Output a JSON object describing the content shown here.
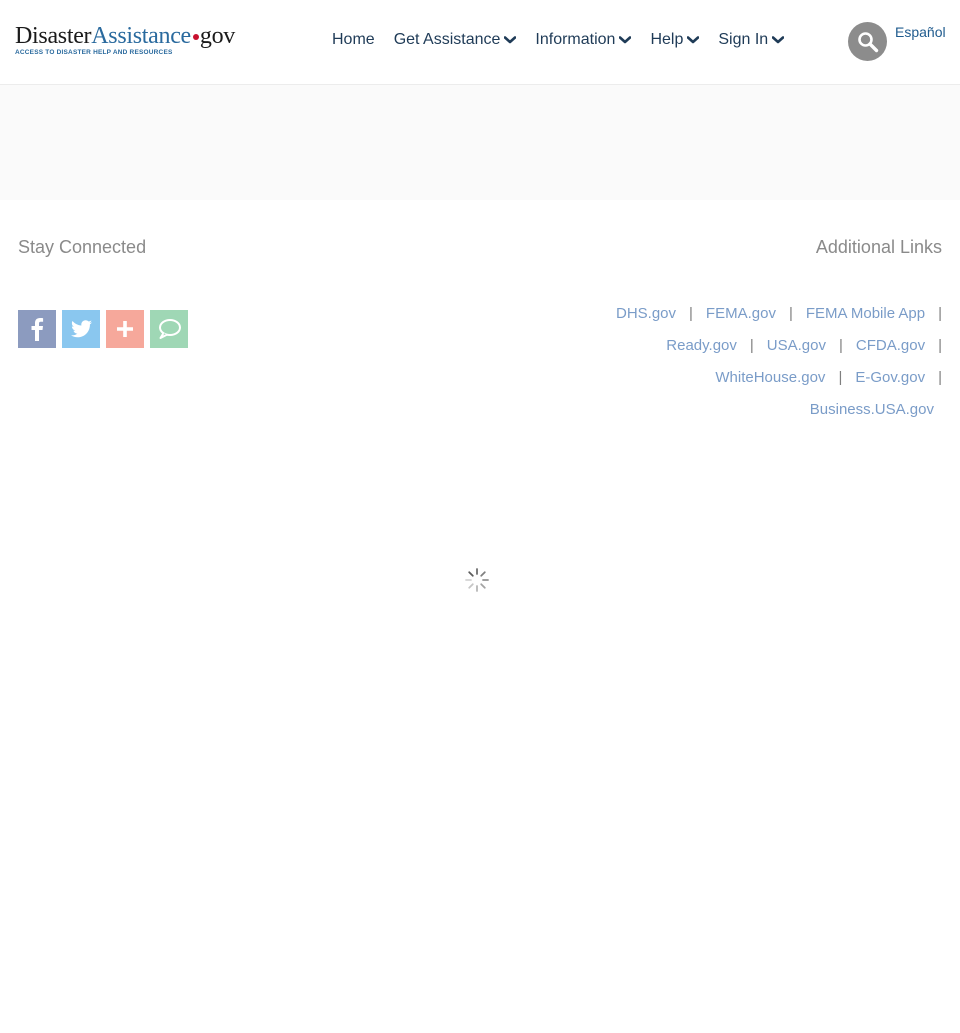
{
  "logo": {
    "part1": "Disaster",
    "part2": "Assistance",
    "part3": "gov",
    "tagline": "ACCESS TO DISASTER HELP AND RESOURCES"
  },
  "nav": {
    "home": "Home",
    "get_assistance": "Get Assistance",
    "information": "Information",
    "help": "Help",
    "sign_in": "Sign In"
  },
  "search_icon": "search-icon",
  "language_link": "Español",
  "stay_connected": {
    "title": "Stay Connected",
    "icons": [
      "facebook-icon",
      "twitter-icon",
      "share-plus-icon",
      "chat-bubble-icon"
    ],
    "colors": {
      "facebook": "#8c9bbf",
      "twitter": "#8ac7ef",
      "plus": "#f6a89b",
      "chat": "#9fd7b5"
    }
  },
  "additional_links": {
    "title": "Additional Links",
    "links": [
      "DHS.gov",
      "FEMA.gov",
      "FEMA Mobile App",
      "Ready.gov",
      "USA.gov",
      "CFDA.gov",
      "WhiteHouse.gov",
      "E-Gov.gov",
      "Business.USA.gov"
    ],
    "separator": "|"
  },
  "loading_indicator": "loading-spinner-icon"
}
